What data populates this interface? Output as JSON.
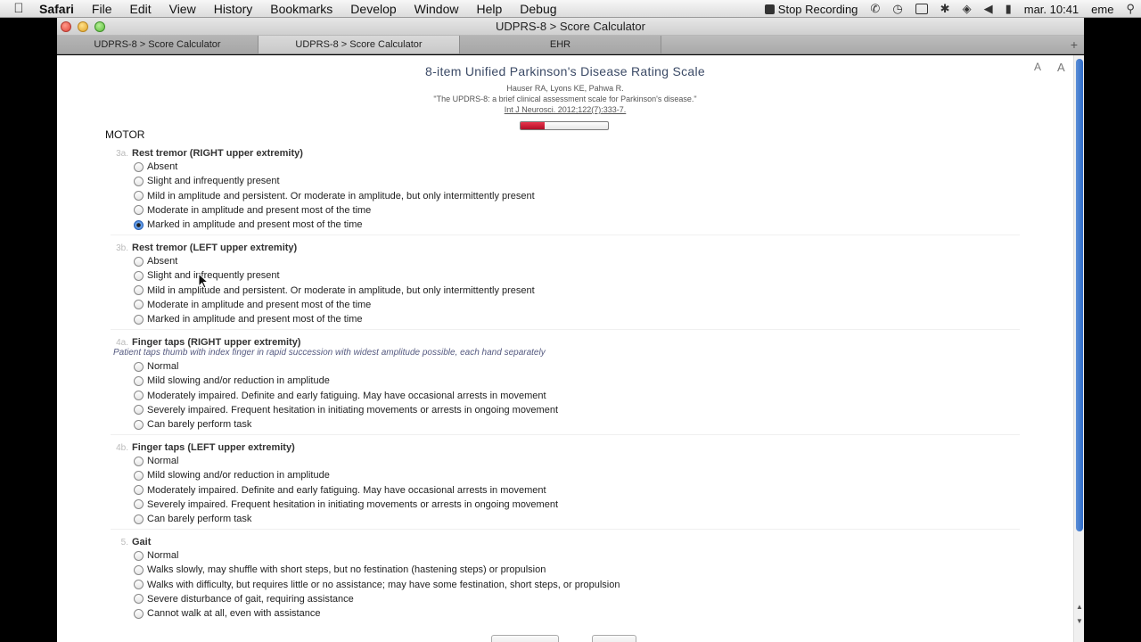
{
  "menubar": {
    "app": "Safari",
    "menus": [
      "File",
      "Edit",
      "View",
      "History",
      "Bookmarks",
      "Develop",
      "Window",
      "Help",
      "Debug"
    ],
    "stop_recording": "Stop Recording",
    "clock": "mar. 10:41",
    "user": "eme"
  },
  "window": {
    "title": "UDPRS-8 > Score Calculator"
  },
  "tabs": [
    {
      "label": "UDPRS-8 > Score Calculator"
    },
    {
      "label": "UDPRS-8 > Score Calculator"
    },
    {
      "label": "EHR"
    }
  ],
  "page": {
    "title": "8-item Unified Parkinson's Disease Rating Scale",
    "authors": "Hauser RA, Lyons KE, Pahwa R.",
    "paper_title": "\"The UPDRS-8: a brief clinical assessment scale for Parkinson's disease.\"",
    "journal": "Int J Neurosci. 2012;122(7):333-7.",
    "font_small": "A",
    "font_large": "A",
    "progress_fraction": 0.28,
    "section": "MOTOR"
  },
  "items": [
    {
      "num": "3a.",
      "name": "Rest tremor (RIGHT upper extremity)",
      "instruction": "",
      "selected": 4,
      "options": [
        "Absent",
        "Slight and infrequently present",
        "Mild in amplitude and persistent. Or moderate in amplitude, but only intermittently present",
        "Moderate in amplitude and present most of the time",
        "Marked in amplitude and present most of the time"
      ]
    },
    {
      "num": "3b.",
      "name": "Rest tremor (LEFT upper extremity)",
      "instruction": "",
      "selected": -1,
      "options": [
        "Absent",
        "Slight and infrequently present",
        "Mild in amplitude and persistent. Or moderate in amplitude, but only intermittently present",
        "Moderate in amplitude and present most of the time",
        "Marked in amplitude and present most of the time"
      ]
    },
    {
      "num": "4a.",
      "name": "Finger taps (RIGHT upper extremity)",
      "instruction": "Patient taps thumb with index finger in rapid succession with widest amplitude possible, each hand separately",
      "selected": -1,
      "options": [
        "Normal",
        "Mild slowing and/or reduction in amplitude",
        "Moderately impaired. Definite and early fatiguing. May have occasional arrests in movement",
        "Severely impaired. Frequent hesitation in initiating movements or arrests in ongoing movement",
        "Can barely perform task"
      ]
    },
    {
      "num": "4b.",
      "name": "Finger taps (LEFT upper extremity)",
      "instruction": "",
      "selected": -1,
      "options": [
        "Normal",
        "Mild slowing and/or reduction in amplitude",
        "Moderately impaired. Definite and early fatiguing. May have occasional arrests in movement",
        "Severely impaired. Frequent hesitation in initiating movements or arrests in ongoing movement",
        "Can barely perform task"
      ]
    },
    {
      "num": "5.",
      "name": "Gait",
      "instruction": "",
      "selected": -1,
      "options": [
        "Normal",
        "Walks slowly, may shuffle with short steps, but no festination (hastening steps) or propulsion",
        "Walks with difficulty, but requires little or no assistance; may have some festination, short steps, or propulsion",
        "Severe disturbance of gait, requiring assistance",
        "Cannot walk at all, even with assistance"
      ]
    }
  ]
}
